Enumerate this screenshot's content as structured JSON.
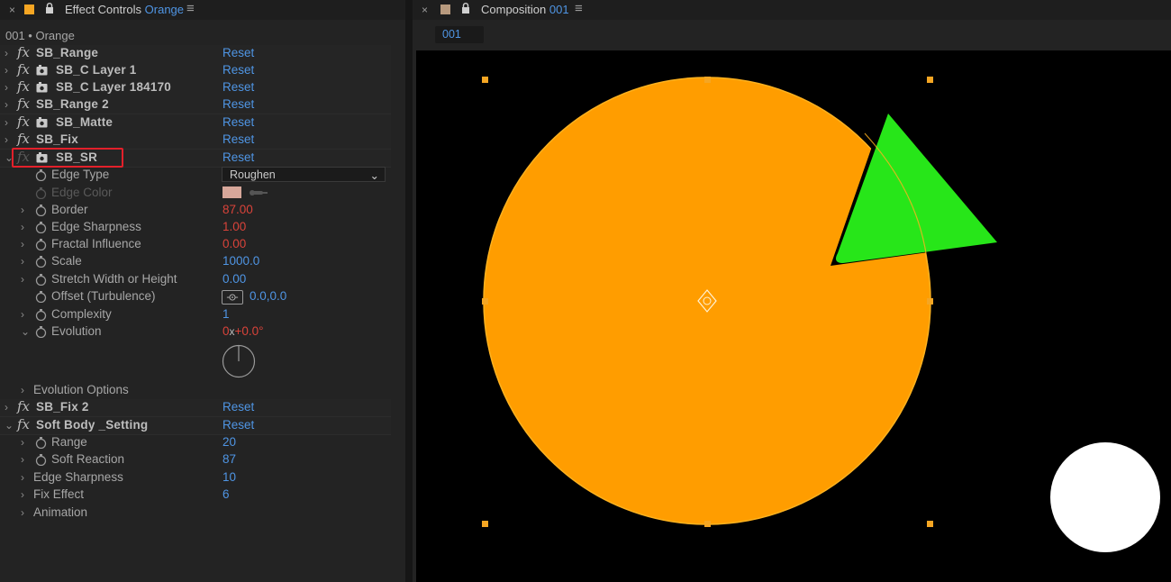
{
  "effect_controls": {
    "tab": {
      "close": "×",
      "label": "Effect Controls",
      "layer": "Orange",
      "menu": "≡",
      "swatch_color": "#f5a623"
    },
    "header": "001 • Orange",
    "effects": [
      {
        "name": "SB_Range",
        "reset": "Reset"
      },
      {
        "name": "SB_C Layer 1",
        "reset": "Reset"
      },
      {
        "name": "SB_C Layer 184170",
        "reset": "Reset"
      },
      {
        "name": "SB_Range 2",
        "reset": "Reset"
      },
      {
        "name": "SB_Matte",
        "reset": "Reset"
      },
      {
        "name": "SB_Fix",
        "reset": "Reset"
      },
      {
        "name": "SB_SR",
        "reset": "Reset"
      }
    ],
    "sb_sr_props": {
      "edge_type": {
        "label": "Edge Type",
        "value": "Roughen"
      },
      "edge_color": {
        "label": "Edge Color",
        "color": "#d7a79a"
      },
      "border": {
        "label": "Border",
        "value": "87.00"
      },
      "edge_sharpness": {
        "label": "Edge Sharpness",
        "value": "1.00"
      },
      "fractal_influence": {
        "label": "Fractal Influence",
        "value": "0.00"
      },
      "scale": {
        "label": "Scale",
        "value": "1000.0"
      },
      "stretch": {
        "label": "Stretch Width or Height",
        "value": "0.00"
      },
      "offset": {
        "label": "Offset (Turbulence)",
        "value": "0.0,0.0"
      },
      "complexity": {
        "label": "Complexity",
        "value": "1"
      },
      "evolution": {
        "label": "Evolution",
        "revs": "0",
        "x": "x",
        "deg": "+0.0°"
      },
      "evolution_options": {
        "label": "Evolution Options"
      }
    },
    "more_effects": [
      {
        "name": "SB_Fix 2",
        "reset": "Reset"
      },
      {
        "name": "Soft Body _Setting",
        "reset": "Reset"
      }
    ],
    "soft_body_props": [
      {
        "label": "Range",
        "value": "20"
      },
      {
        "label": "Soft Reaction",
        "value": "87"
      },
      {
        "label": "Edge Sharpness",
        "value": "10"
      },
      {
        "label": "Fix Effect",
        "value": "6"
      },
      {
        "label": "Animation",
        "value": ""
      }
    ]
  },
  "composition": {
    "tab": {
      "close": "×",
      "label": "Composition",
      "name": "001",
      "menu": "≡",
      "swatch_color": "#b89a7e"
    },
    "comp_tab": "001",
    "colors": {
      "background": "#000000",
      "circle": "#ff9d00",
      "triangle": "#27e619",
      "white_circle": "#ffffff",
      "handle": "#f5a623"
    }
  }
}
